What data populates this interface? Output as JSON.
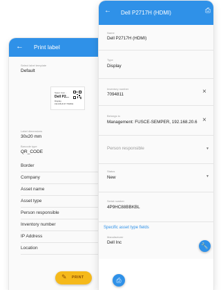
{
  "print_screen": {
    "title": "Print label",
    "back_icon": "arrow-left-icon",
    "template_label": "Select label template",
    "template_value": "Default",
    "preview": {
      "line1": "Super Com...",
      "line2": "Dell P2...",
      "line3": "Display",
      "line4": "192.168.20.67 7094811"
    },
    "dimensions_label": "Label dimensions",
    "dimensions_value": "30x20 mm",
    "barcode_label": "Barcode type",
    "barcode_value": "QR_CODE",
    "options": [
      "Border",
      "Company",
      "Asset name",
      "Asset type",
      "Person responsible",
      "Inventory number",
      "IP Address",
      "Location"
    ],
    "print_button": "PRINT",
    "accent": "#2f91e8",
    "print_color": "#f5b91b"
  },
  "asset_screen": {
    "title": "Dell P2717H (HDMI)",
    "back_icon": "arrow-left-icon",
    "printer_icon": "printer-icon",
    "fields": {
      "name_label": "Name",
      "name_value": "Dell P2717H (HDMI)",
      "type_label": "Type",
      "type_value": "Display",
      "inventory_label": "Inventory number",
      "inventory_value": "7094811",
      "belongs_label": "Belongs to",
      "belongs_value": "Management: FUSCE-SEMPER, 192.168.20.6",
      "person_placeholder": "Person responsible",
      "status_label": "Status",
      "status_value": "New",
      "serial_label": "Serial number",
      "serial_value": "4P9HC88BBKBL"
    },
    "specific_header": "Specific asset type fields",
    "manufacturer_label": "Manufacturer",
    "manufacturer_value": "Dell Inc"
  }
}
